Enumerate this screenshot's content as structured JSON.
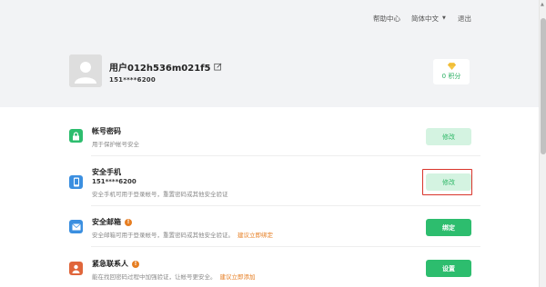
{
  "nav": {
    "help": "帮助中心",
    "language": "简体中文",
    "logout": "退出"
  },
  "profile": {
    "username": "用户012h536m021f5",
    "phone": "151****6200",
    "points": "0 积分"
  },
  "sections": [
    {
      "title": "帐号密码",
      "desc": "用于保护帐号安全",
      "button": "修改",
      "icon": "lock-icon",
      "color": "#2dbd6e"
    },
    {
      "title": "安全手机",
      "value": "151****6200",
      "desc": "安全手机可用于登录帐号，重置密码或其他安全验证",
      "button": "修改",
      "icon": "phone-icon",
      "color": "#3b8fe0"
    },
    {
      "title": "安全邮箱",
      "desc": "安全邮箱可用于登录帐号，重置密码或其他安全验证。",
      "link": "建议立即绑定",
      "button": "绑定",
      "icon": "mail-icon",
      "color": "#3b8fe0"
    },
    {
      "title": "紧急联系人",
      "desc": "能在找回密码过程中加强验证，让帐号更安全。",
      "link": "建议立即添加",
      "button": "设置",
      "icon": "contact-icon",
      "color": "#e0663b"
    }
  ],
  "colors": {
    "accent": "#2dbd6e",
    "warning": "#e67e22",
    "highlight": "#d9342b"
  }
}
